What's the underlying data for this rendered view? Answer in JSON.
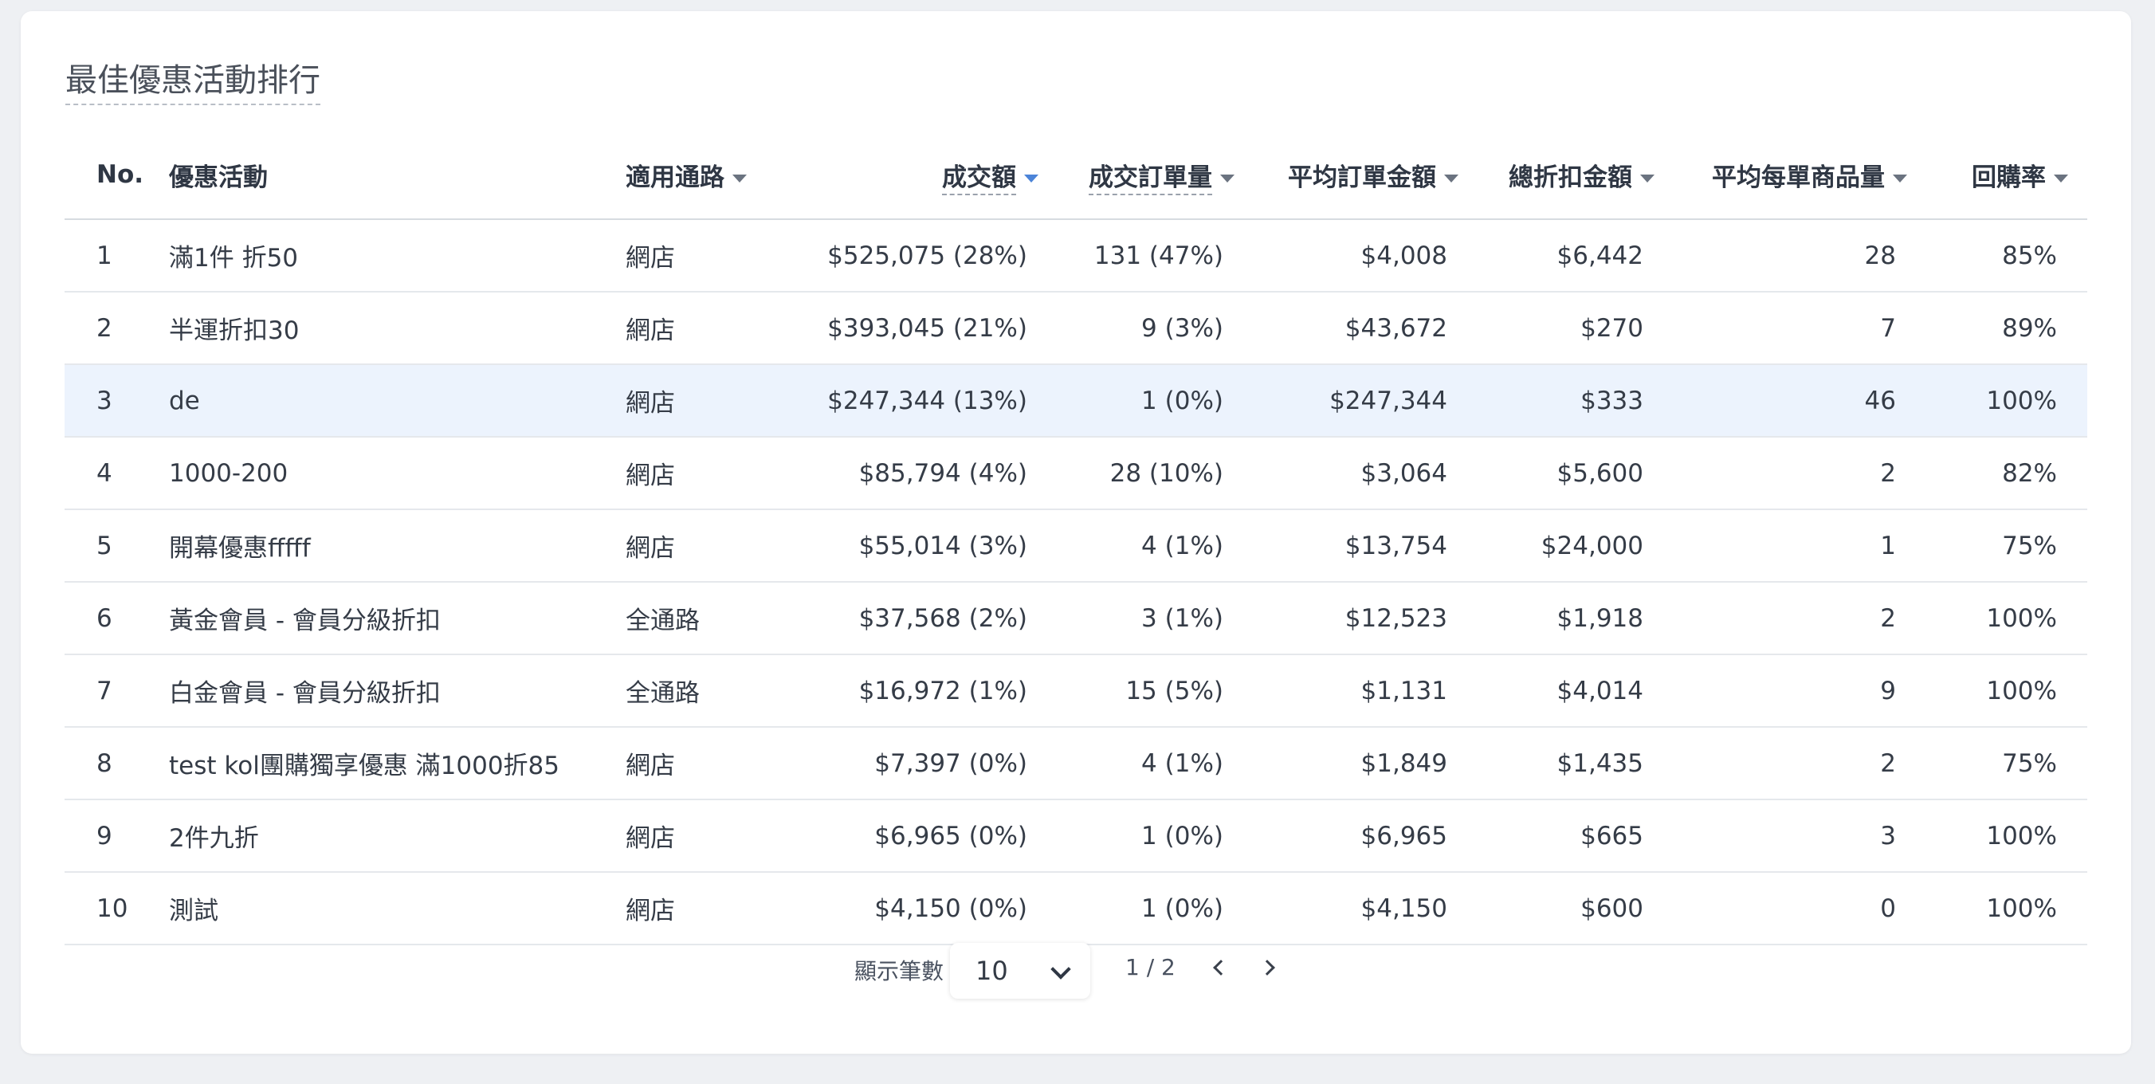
{
  "title": "最佳優惠活動排行",
  "columns": {
    "no": "No.",
    "campaign": "優惠活動",
    "channel": "適用通路",
    "revenue": "成交額",
    "orders": "成交訂單量",
    "avg_order": "平均訂單金額",
    "discount": "總折扣金額",
    "avg_items": "平均每單商品量",
    "repurchase": "回購率"
  },
  "rows": [
    {
      "no": "1",
      "campaign": "滿1件 折50",
      "channel": "網店",
      "revenue": "$525,075 (28%)",
      "orders": "131 (47%)",
      "avg_order": "$4,008",
      "discount": "$6,442",
      "avg_items": "28",
      "repurchase": "85%"
    },
    {
      "no": "2",
      "campaign": "半運折扣30",
      "channel": "網店",
      "revenue": "$393,045 (21%)",
      "orders": "9 (3%)",
      "avg_order": "$43,672",
      "discount": "$270",
      "avg_items": "7",
      "repurchase": "89%"
    },
    {
      "no": "3",
      "campaign": "de",
      "channel": "網店",
      "revenue": "$247,344 (13%)",
      "orders": "1 (0%)",
      "avg_order": "$247,344",
      "discount": "$333",
      "avg_items": "46",
      "repurchase": "100%"
    },
    {
      "no": "4",
      "campaign": "1000-200",
      "channel": "網店",
      "revenue": "$85,794 (4%)",
      "orders": "28 (10%)",
      "avg_order": "$3,064",
      "discount": "$5,600",
      "avg_items": "2",
      "repurchase": "82%"
    },
    {
      "no": "5",
      "campaign": "開幕優惠fffff",
      "channel": "網店",
      "revenue": "$55,014 (3%)",
      "orders": "4 (1%)",
      "avg_order": "$13,754",
      "discount": "$24,000",
      "avg_items": "1",
      "repurchase": "75%"
    },
    {
      "no": "6",
      "campaign": "黃金會員 - 會員分級折扣",
      "channel": "全通路",
      "revenue": "$37,568 (2%)",
      "orders": "3 (1%)",
      "avg_order": "$12,523",
      "discount": "$1,918",
      "avg_items": "2",
      "repurchase": "100%"
    },
    {
      "no": "7",
      "campaign": "白金會員 - 會員分級折扣",
      "channel": "全通路",
      "revenue": "$16,972 (1%)",
      "orders": "15 (5%)",
      "avg_order": "$1,131",
      "discount": "$4,014",
      "avg_items": "9",
      "repurchase": "100%"
    },
    {
      "no": "8",
      "campaign": "test kol團購獨享優惠 滿1000折85",
      "channel": "網店",
      "revenue": "$7,397 (0%)",
      "orders": "4 (1%)",
      "avg_order": "$1,849",
      "discount": "$1,435",
      "avg_items": "2",
      "repurchase": "75%"
    },
    {
      "no": "9",
      "campaign": "2件九折",
      "channel": "網店",
      "revenue": "$6,965 (0%)",
      "orders": "1 (0%)",
      "avg_order": "$6,965",
      "discount": "$665",
      "avg_items": "3",
      "repurchase": "100%"
    },
    {
      "no": "10",
      "campaign": "測試",
      "channel": "網店",
      "revenue": "$4,150 (0%)",
      "orders": "1 (0%)",
      "avg_order": "$4,150",
      "discount": "$600",
      "avg_items": "0",
      "repurchase": "100%"
    }
  ],
  "highlighted_row": "3",
  "pagination": {
    "page_size_label": "顯示筆數",
    "page_size": "10",
    "page_text": "1 / 2"
  },
  "icons": {
    "sort": "caret-down-icon",
    "active_sort_color": "#4c84d8",
    "dropdown": "chevron-down-icon",
    "prev": "chevron-left-icon",
    "next": "chevron-right-icon"
  },
  "colors": {
    "highlight_row_bg": "#ecf3fd",
    "card_bg": "#ffffff",
    "page_bg": "#eef0f3"
  }
}
